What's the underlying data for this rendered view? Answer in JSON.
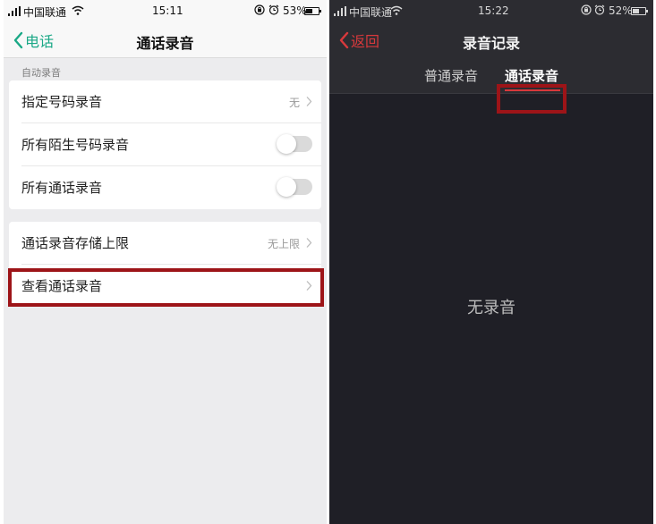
{
  "left": {
    "status": {
      "carrier": "中国联通",
      "time": "15:11",
      "battery": "53%",
      "battery_level": 0.53
    },
    "nav": {
      "back_label": "电话",
      "title": "通话录音"
    },
    "section_label": "自动录音",
    "group1": [
      {
        "label": "指定号码录音",
        "value": "无",
        "type": "link"
      },
      {
        "label": "所有陌生号码录音",
        "type": "toggle",
        "on": false
      },
      {
        "label": "所有通话录音",
        "type": "toggle",
        "on": false
      }
    ],
    "group2": [
      {
        "label": "通话录音存储上限",
        "value": "无上限",
        "type": "link"
      },
      {
        "label": "查看通话录音",
        "type": "link"
      }
    ]
  },
  "right": {
    "status": {
      "carrier": "中国联通",
      "time": "15:22",
      "battery": "52%",
      "battery_level": 0.52
    },
    "nav": {
      "back_label": "返回",
      "title": "录音记录"
    },
    "tabs": [
      {
        "label": "普通录音",
        "active": false
      },
      {
        "label": "通话录音",
        "active": true
      }
    ],
    "empty_text": "无录音"
  },
  "colors": {
    "accent_green": "#1aa886",
    "accent_red": "#d8393c",
    "highlight_box": "#9d1418"
  }
}
